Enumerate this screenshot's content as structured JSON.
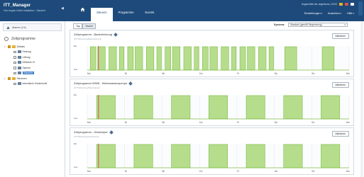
{
  "brand": {
    "title": "ITT_Manager",
    "subtitle": "Geo Angelo Holler Installation - Standort"
  },
  "tabs": [
    {
      "label": "Steuern"
    },
    {
      "label": "Programme"
    },
    {
      "label": "Events"
    }
  ],
  "user": {
    "line": "Angemeldet als: angelomax | 00:00"
  },
  "menus": [
    {
      "label": "Einstellungen"
    },
    {
      "label": "Ansichten"
    },
    {
      "label": "Hilfe"
    }
  ],
  "sidebar": {
    "alarm": "Alarme (1/4)",
    "title": "Zeitprogramme",
    "tree": [
      {
        "label": "Zeitsteu",
        "level": 0,
        "type": "folder"
      },
      {
        "label": "Heizung",
        "level": 1,
        "type": "sched"
      },
      {
        "label": "Lüftung",
        "level": 1,
        "type": "sched"
      },
      {
        "label": "Zeitblock 01",
        "level": 1,
        "type": "sched"
      },
      {
        "label": "Sperren",
        "level": 1,
        "type": "sched"
      },
      {
        "label": "Brauchw",
        "level": 1,
        "type": "sched",
        "selected": true
      },
      {
        "label": "Sensoren",
        "level": 0,
        "type": "folder"
      },
      {
        "label": "Intervalluhr Sommerzeit",
        "level": 1,
        "type": "sched"
      }
    ]
  },
  "controls": {
    "views": [
      {
        "label": "Tag"
      },
      {
        "label": "Woche"
      }
    ],
    "system_label": "Systeme",
    "system_value": "Standard (gemäß Eingrenzung)"
  },
  "panels": [
    {
      "title": "Zeitprogramm - Badenheizung",
      "path": "/HTTM/Heizung/Badenheizung/",
      "button": "Aktivieren"
    },
    {
      "title": "Zeitprogramm WWB - Warmwasserpumpe",
      "path": "/HTTM/Heizung/Warmwasser/",
      "button": "Aktivieren"
    },
    {
      "title": "Zeitprogramm - Heizkörper",
      "path": "/HTTM/Heizung/Heizkoerper/",
      "button": "Aktivieren"
    }
  ],
  "chart_data": [
    {
      "type": "area",
      "y_categories": [
        "Aus",
        "Ein"
      ],
      "x_ticks": [
        "Mo",
        "Di",
        "Mi",
        "Do",
        "Fr",
        "Sa",
        "So",
        "Mo"
      ],
      "x_range_days": [
        0,
        7
      ],
      "current_time_day": 0.3,
      "on_intervals_days": [
        [
          0.08,
          0.23
        ],
        [
          0.28,
          0.48
        ],
        [
          0.58,
          0.78
        ],
        [
          0.86,
          0.98
        ],
        [
          1.08,
          1.23
        ],
        [
          1.28,
          1.48
        ],
        [
          1.58,
          1.78
        ],
        [
          1.86,
          1.98
        ],
        [
          2.08,
          2.23
        ],
        [
          2.28,
          2.48
        ],
        [
          2.58,
          2.78
        ],
        [
          2.86,
          2.98
        ],
        [
          3.08,
          3.23
        ],
        [
          3.28,
          3.48
        ],
        [
          3.58,
          3.78
        ],
        [
          3.86,
          3.98
        ],
        [
          4.08,
          4.23
        ],
        [
          4.28,
          4.48
        ],
        [
          4.58,
          4.78
        ],
        [
          4.86,
          4.98
        ],
        [
          5.28,
          5.6
        ],
        [
          6.28,
          6.6
        ]
      ]
    },
    {
      "type": "area",
      "y_categories": [
        "Aus",
        "Ein"
      ],
      "x_ticks": [
        "Mo",
        "Di",
        "Mi",
        "Do",
        "Fr",
        "Sa",
        "So",
        "Mo"
      ],
      "x_range_days": [
        0,
        7
      ],
      "current_time_day": 0.3,
      "on_intervals_days": [
        [
          0.25,
          0.75
        ],
        [
          1.25,
          1.75
        ],
        [
          2.25,
          2.75
        ],
        [
          3.25,
          3.75
        ],
        [
          4.25,
          4.75
        ],
        [
          5.25,
          5.75
        ],
        [
          6.25,
          6.75
        ]
      ]
    },
    {
      "type": "area",
      "y_categories": [
        "Aus",
        "Ein"
      ],
      "x_ticks": [
        "Mo",
        "Di",
        "Mi",
        "Do",
        "Fr",
        "Sa",
        "So",
        "Mo"
      ],
      "x_range_days": [
        0,
        7
      ],
      "current_time_day": 0.3,
      "on_intervals_days": [
        [
          0.25,
          0.75
        ],
        [
          1.25,
          1.75
        ],
        [
          2.25,
          2.75
        ],
        [
          3.25,
          3.75
        ],
        [
          4.25,
          4.75
        ],
        [
          5.25,
          5.75
        ],
        [
          6.25,
          6.75
        ]
      ]
    }
  ],
  "colors": {
    "topbar": "#1d4a7a",
    "on_fill": "#b6dd8c",
    "on_stroke": "#7cbd45",
    "now_line": "#d9534f",
    "selected": "#3a7bc8"
  },
  "icons": {
    "home": "home-icon",
    "alarm": "warning-icon",
    "edit": "pencil-icon",
    "program": "clock-icon"
  }
}
